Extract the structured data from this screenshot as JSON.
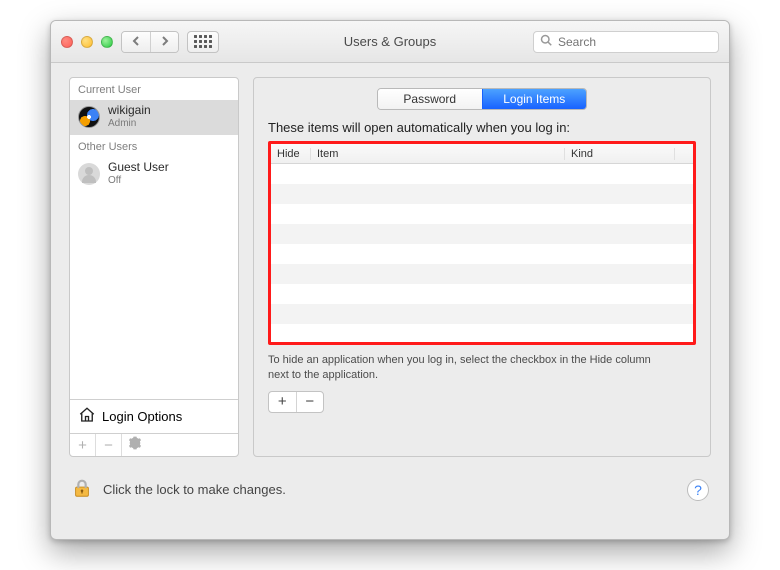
{
  "window": {
    "title": "Users & Groups"
  },
  "search": {
    "placeholder": "Search"
  },
  "sidebar": {
    "current_label": "Current User",
    "other_label": "Other Users",
    "users": [
      {
        "name": "wikigain",
        "sub": "Admin"
      },
      {
        "name": "Guest User",
        "sub": "Off"
      }
    ],
    "login_options_label": "Login Options"
  },
  "tabs": {
    "password": "Password",
    "login_items": "Login Items"
  },
  "main": {
    "description": "These items will open automatically when you log in:",
    "col_hide": "Hide",
    "col_item": "Item",
    "col_kind": "Kind",
    "hint": "To hide an application when you log in, select the checkbox in the Hide column next to the application.",
    "add": "+",
    "remove": "−"
  },
  "lock": {
    "message": "Click the lock to make changes."
  },
  "help": {
    "label": "?"
  }
}
